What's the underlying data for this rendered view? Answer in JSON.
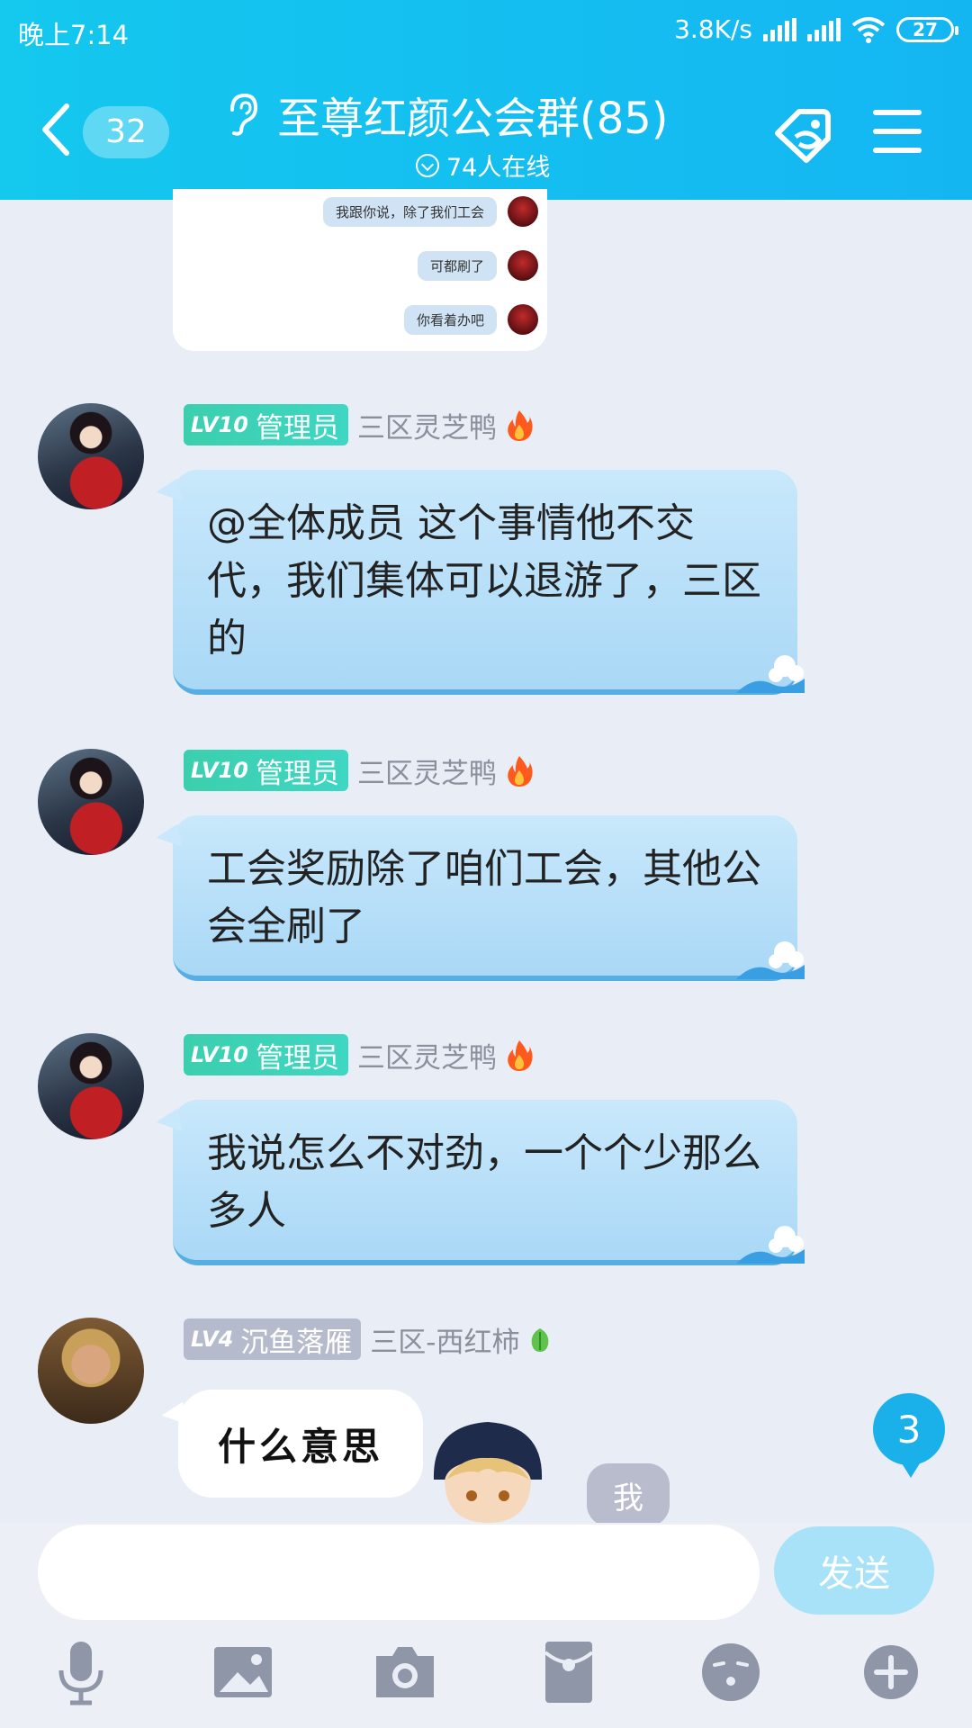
{
  "status_bar": {
    "time": "晚上7:14",
    "speed": "3.8K/s",
    "battery": "27"
  },
  "header": {
    "unread_count": "32",
    "title": "至尊红颜公会群(85)",
    "online_text": "74人在线"
  },
  "previous_image": {
    "lines": [
      "我跟你说，除了我们工会",
      "可都刷了",
      "你看着办吧"
    ]
  },
  "messages": [
    {
      "level": "LV10",
      "role": "管理员",
      "nickname": "三区灵芝鸭",
      "badge_icon": "flame-icon",
      "text": "@全体成员 这个事情他不交代，我们集体可以退游了，三区的"
    },
    {
      "level": "LV10",
      "role": "管理员",
      "nickname": "三区灵芝鸭",
      "badge_icon": "flame-icon",
      "text": "工会奖励除了咱们工会，其他公会全刷了"
    },
    {
      "level": "LV10",
      "role": "管理员",
      "nickname": "三区灵芝鸭",
      "badge_icon": "flame-icon",
      "text": "我说怎么不对劲，一个个少那么多人"
    },
    {
      "level": "LV4",
      "role": "沉鱼落雁",
      "nickname": "三区-西红柿",
      "badge_icon": "sprout-icon",
      "text": "什么意思"
    }
  ],
  "me_tag": "我",
  "new_message_count": "3",
  "input": {
    "value": "",
    "placeholder": "",
    "send_label": "发送"
  },
  "toolbar_icons": [
    "microphone-icon",
    "picture-icon",
    "camera-icon",
    "red-packet-icon",
    "emoji-icon",
    "plus-icon"
  ],
  "colors": {
    "header": "#14c0f0",
    "bubble": "#b8e0f9",
    "admin_badge": "#3ccfae",
    "level_badge": "#b6bacd",
    "unread": "#1ab0ea"
  }
}
